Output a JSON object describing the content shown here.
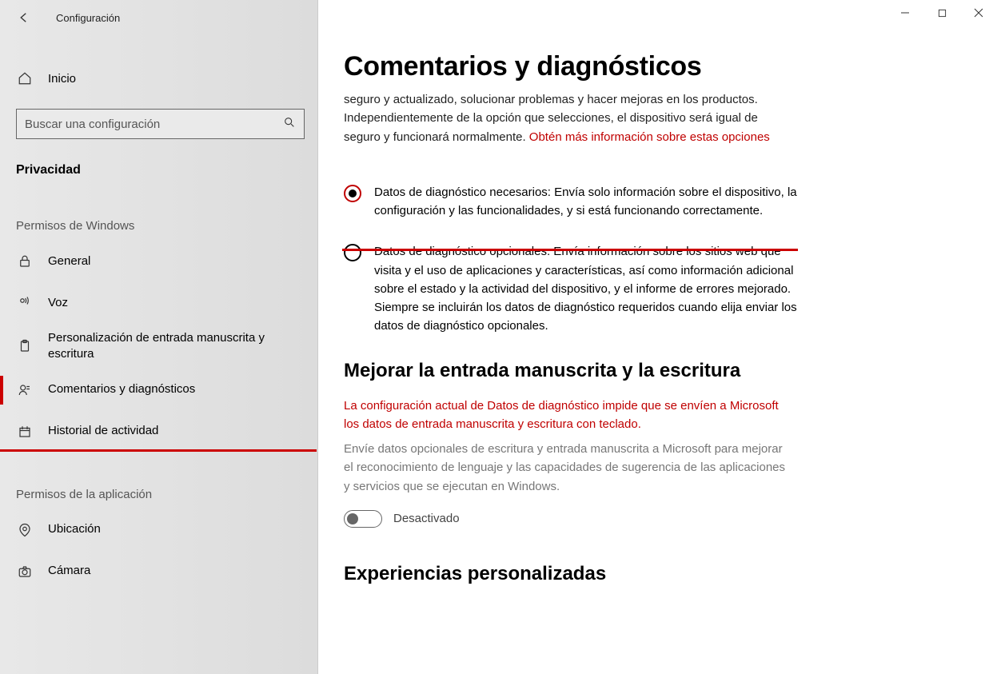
{
  "window": {
    "title": "Configuración"
  },
  "sidebar": {
    "home": "Inicio",
    "search_placeholder": "Buscar una configuración",
    "section": "Privacidad",
    "group1": "Permisos de Windows",
    "group2": "Permisos de la aplicación",
    "items1": [
      {
        "label": "General"
      },
      {
        "label": "Voz"
      },
      {
        "label": "Personalización de entrada manuscrita y escritura"
      },
      {
        "label": "Comentarios y diagnósticos"
      },
      {
        "label": "Historial de actividad"
      }
    ],
    "items2": [
      {
        "label": "Ubicación"
      },
      {
        "label": "Cámara"
      }
    ]
  },
  "main": {
    "heading": "Comentarios y diagnósticos",
    "intro_plain": "seguro y actualizado, solucionar problemas y hacer mejoras en los productos. Independientemente de la opción que selecciones, el dispositivo será igual de seguro y funcionará normalmente. ",
    "intro_link": "Obtén más información sobre estas opciones",
    "radio1": "Datos de diagnóstico necesarios: Envía solo información sobre el dispositivo, la configuración y las funcionalidades, y si está funcionando correctamente.",
    "radio2": "Datos de diagnóstico opcionales: Envía información sobre los sitios web que visita y el uso de aplicaciones y características, así como información adicional sobre el estado y la actividad del dispositivo, y el informe de errores mejorado. Siempre se incluirán los datos de diagnóstico requeridos cuando elija enviar los datos de diagnóstico opcionales.",
    "sub1": "Mejorar la entrada manuscrita y la escritura",
    "warn": "La configuración actual de Datos de diagnóstico impide que se envíen a Microsoft los datos de entrada manuscrita y escritura con teclado.",
    "muted": "Envíe datos opcionales de escritura y entrada manuscrita a Microsoft para mejorar el reconocimiento de lenguaje y las capacidades de sugerencia de las aplicaciones y servicios que se ejecutan en Windows.",
    "toggle_label": "Desactivado",
    "sub2": "Experiencias personalizadas"
  }
}
